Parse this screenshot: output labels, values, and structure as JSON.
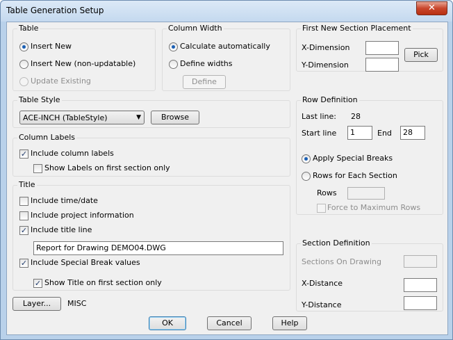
{
  "window": {
    "title": "Table Generation Setup",
    "close_glyph": "✕"
  },
  "table_group": {
    "title": "Table",
    "options": [
      "Insert New",
      "Insert New (non-updatable)",
      "Update Existing"
    ],
    "selected": "Insert New"
  },
  "column_width_group": {
    "title": "Column Width",
    "options": [
      "Calculate automatically",
      "Define widths"
    ],
    "selected": "Calculate automatically",
    "define_button": "Define"
  },
  "first_section_group": {
    "title": "First New Section Placement",
    "x_label": "X-Dimension",
    "y_label": "Y-Dimension",
    "x_value": "",
    "y_value": "",
    "pick_button": "Pick"
  },
  "table_style_group": {
    "title": "Table Style",
    "selected_style": "ACE-INCH  (TableStyle)",
    "browse_button": "Browse"
  },
  "row_definition_group": {
    "title": "Row Definition",
    "last_line_label": "Last line:",
    "last_line_value": "28",
    "start_line_label": "Start line",
    "start_line_value": "1",
    "end_label": "End",
    "end_value": "28",
    "options": [
      "Apply Special Breaks",
      "Rows for Each Section"
    ],
    "selected": "Apply Special Breaks",
    "rows_label": "Rows",
    "rows_value": "",
    "force_max_label": "Force to Maximum Rows"
  },
  "column_labels_group": {
    "title": "Column Labels",
    "include_label": "Include column labels",
    "show_first_label": "Show Labels on first section only"
  },
  "title_group": {
    "title": "Title",
    "include_time_label": "Include time/date",
    "include_project_label": "Include project information",
    "include_title_line_label": "Include title line",
    "title_line_value": "Report for Drawing DEMO04.DWG",
    "include_special_break_label": "Include Special Break values",
    "show_title_first_label": "Show Title on first section only"
  },
  "section_definition_group": {
    "title": "Section Definition",
    "sections_label": "Sections On Drawing",
    "x_distance_label": "X-Distance",
    "y_distance_label": "Y-Distance",
    "sections_value": "",
    "x_distance_value": "",
    "y_distance_value": ""
  },
  "layer": {
    "button": "Layer...",
    "value": "MISC"
  },
  "footer": {
    "ok": "OK",
    "cancel": "Cancel",
    "help": "Help"
  },
  "check_glyph": "✓"
}
